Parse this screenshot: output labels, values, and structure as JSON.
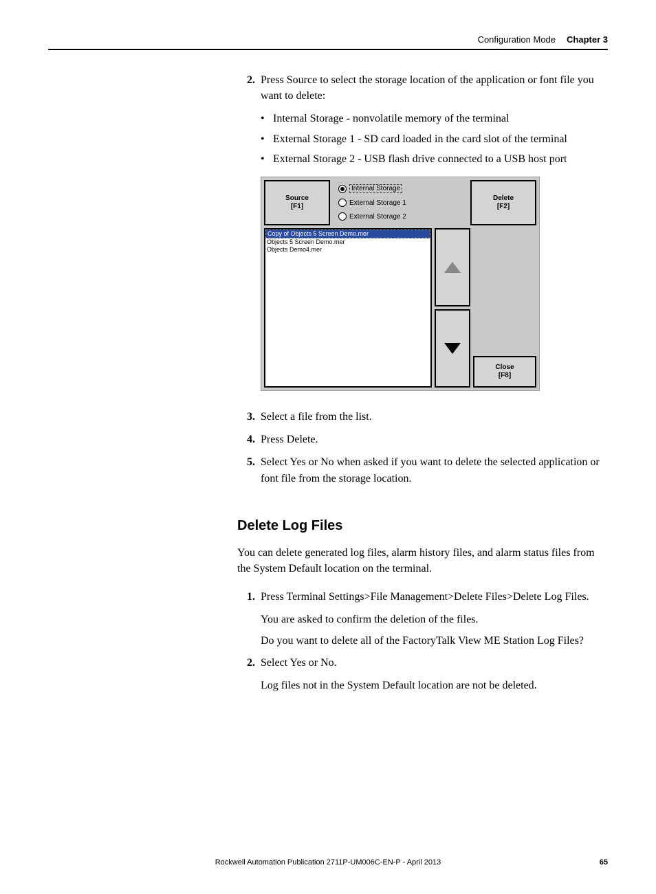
{
  "header": {
    "section": "Configuration Mode",
    "chapter": "Chapter 3"
  },
  "step2": {
    "num": "2.",
    "text": "Press Source to select the storage location of the application or font file you want to delete:",
    "bullets": [
      "Internal Storage - nonvolatile memory of the terminal",
      "External Storage 1 - SD card loaded in the card slot of the terminal",
      "External Storage 2 - USB flash drive connected to a USB host port"
    ]
  },
  "ui": {
    "source_btn": {
      "l1": "Source",
      "l2": "[F1]"
    },
    "radios": [
      {
        "label": "Internal Storage",
        "selected": true
      },
      {
        "label": "External Storage 1",
        "selected": false
      },
      {
        "label": "External Storage 2",
        "selected": false
      }
    ],
    "delete_btn": {
      "l1": "Delete",
      "l2": "[F2]"
    },
    "list": [
      {
        "text": "Copy of Objects 5 Screen Demo.mer",
        "selected": true
      },
      {
        "text": "Objects 5 Screen Demo.mer",
        "selected": false
      },
      {
        "text": "Objects Demo4.mer",
        "selected": false
      }
    ],
    "close_btn": {
      "l1": "Close",
      "l2": "[F8]"
    }
  },
  "step3": {
    "num": "3.",
    "text": "Select a file from the list."
  },
  "step4": {
    "num": "4.",
    "text": "Press Delete."
  },
  "step5": {
    "num": "5.",
    "text": "Select Yes or No when asked if you want to delete the selected application or font file from the storage location."
  },
  "heading": "Delete Log Files",
  "intro": "You can delete generated log files, alarm history files, and alarm status files from the System Default location on the terminal.",
  "d_step1": {
    "num": "1.",
    "text": "Press Terminal Settings>File Management>Delete Files>Delete Log Files.",
    "p1": "You are asked to confirm the deletion of the files.",
    "p2": "Do you want to delete all of the FactoryTalk View ME Station Log Files?"
  },
  "d_step2": {
    "num": "2.",
    "text": "Select Yes or No.",
    "p1": "Log files not in the System Default location are not be deleted."
  },
  "footer": {
    "text": "Rockwell Automation Publication 2711P-UM006C-EN-P - April 2013",
    "page": "65"
  }
}
